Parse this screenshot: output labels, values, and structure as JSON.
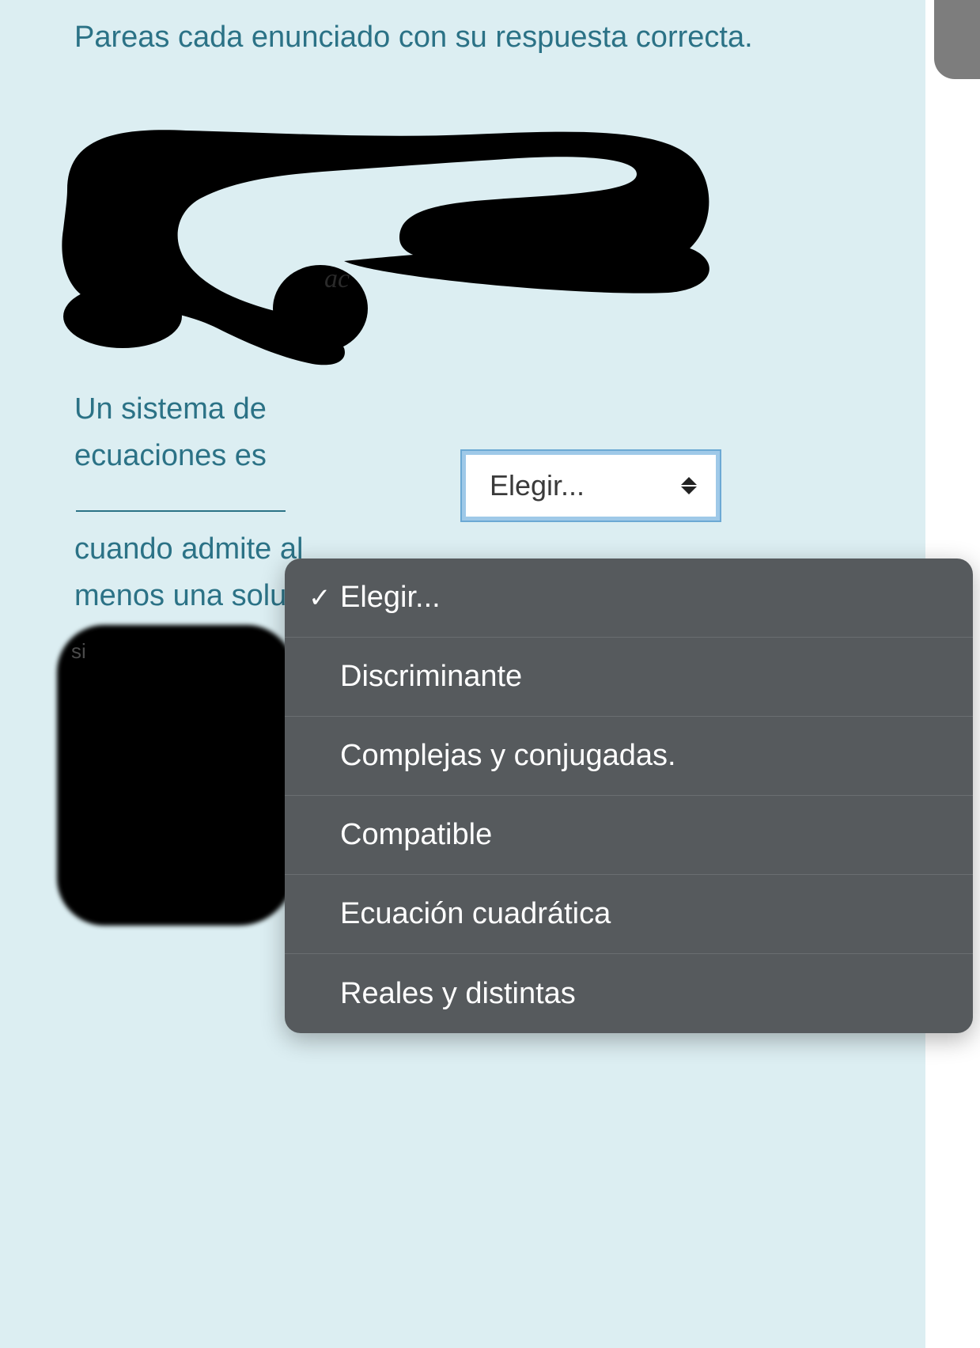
{
  "instruction": "Pareas cada enunciado con su respuesta correcta.",
  "partial_text": "ac",
  "question": {
    "line1": "Un sistema de ecuaciones es",
    "line2": "cuando admite al menos una solución."
  },
  "select": {
    "current": "Elegir..."
  },
  "dropdown": {
    "options": [
      {
        "label": "Elegir...",
        "selected": true
      },
      {
        "label": "Discriminante",
        "selected": false
      },
      {
        "label": "Complejas y conjugadas.",
        "selected": false
      },
      {
        "label": "Compatible",
        "selected": false
      },
      {
        "label": "Ecuación cuadrática",
        "selected": false
      },
      {
        "label": "Reales y distintas",
        "selected": false
      }
    ]
  },
  "redacted_hint": "si"
}
